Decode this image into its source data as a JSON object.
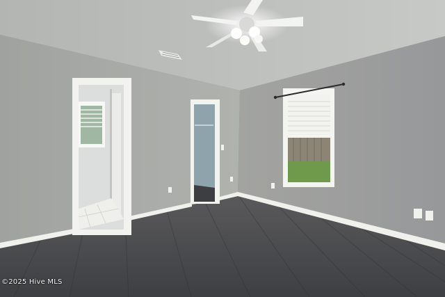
{
  "photo": {
    "watermark": "©2025 Hive MLS",
    "colors": {
      "wall_left": "#a9aba7",
      "wall_right": "#9c9d98",
      "ceiling": "#bfc1bf",
      "floor": "#4a4b4d",
      "trim": "#f0f0ec"
    },
    "icons": [
      "ceiling-fan-icon",
      "air-vent-icon",
      "curtain-rod-icon"
    ]
  }
}
